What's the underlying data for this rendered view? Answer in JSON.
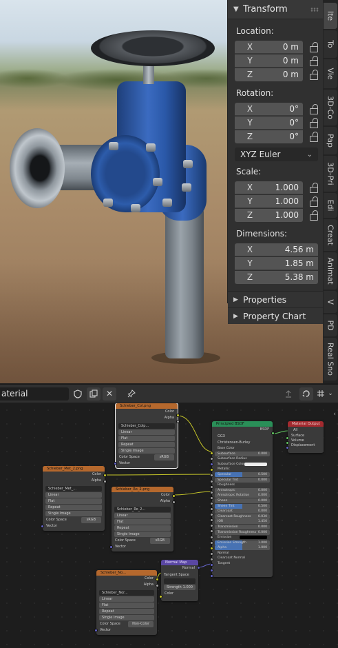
{
  "npanel": {
    "transform_title": "Transform",
    "location_label": "Location:",
    "location": [
      {
        "axis": "X",
        "value": "0 m"
      },
      {
        "axis": "Y",
        "value": "0 m"
      },
      {
        "axis": "Z",
        "value": "0 m"
      }
    ],
    "rotation_label": "Rotation:",
    "rotation": [
      {
        "axis": "X",
        "value": "0°"
      },
      {
        "axis": "Y",
        "value": "0°"
      },
      {
        "axis": "Z",
        "value": "0°"
      }
    ],
    "rotation_mode": "XYZ Euler",
    "scale_label": "Scale:",
    "scale": [
      {
        "axis": "X",
        "value": "1.000"
      },
      {
        "axis": "Y",
        "value": "1.000"
      },
      {
        "axis": "Z",
        "value": "1.000"
      }
    ],
    "dimensions_label": "Dimensions:",
    "dimensions": [
      {
        "axis": "X",
        "value": "4.56 m"
      },
      {
        "axis": "Y",
        "value": "1.85 m"
      },
      {
        "axis": "Z",
        "value": "5.38 m"
      }
    ],
    "properties_label": "Properties",
    "property_chart_label": "Property Chart"
  },
  "vtabs": [
    "Ite",
    "To",
    "Vie",
    "3D-Co",
    "Pap",
    "3D-Pri",
    "Edi",
    "Creat",
    "Animat",
    "V",
    "PD",
    "Real Sno"
  ],
  "node_header": {
    "material_name": "aterial"
  },
  "nodes": {
    "color_tex": {
      "title": "Schieber_Col.png",
      "out1": "Color",
      "out2": "Alpha",
      "image": "Schieber_Colp...",
      "interp": "Linear",
      "proj": "Flat",
      "ext": "Repeat",
      "source": "Single Image",
      "cs_label": "Color Space",
      "cs_value": "sRGB",
      "vector": "Vector"
    },
    "met_tex": {
      "title": "Schieber_Met_2.png",
      "out1": "Color",
      "out2": "Alpha",
      "image": "Schieber_Met_...",
      "interp": "Linear",
      "proj": "Flat",
      "ext": "Repeat",
      "source": "Single Image",
      "cs_label": "Color Space",
      "cs_value": "sRGB",
      "vector": "Vector"
    },
    "ro_tex": {
      "title": "Schieber_Ro_2.png",
      "out1": "Color",
      "out2": "Alpha",
      "image": "Schieber_Ro_2...",
      "interp": "Linear",
      "proj": "Flat",
      "ext": "Repeat",
      "source": "Single Image",
      "cs_label": "Color Space",
      "cs_value": "sRGB",
      "vector": "Vector"
    },
    "nor_tex": {
      "title": "Schieber_No...",
      "out1": "Color",
      "out2": "Alpha",
      "image": "Schieber_Nor...",
      "interp": "Linear",
      "proj": "Flat",
      "ext": "Repeat",
      "source": "Single Image",
      "cs_label": "Color Space",
      "cs_value": "Non-Color",
      "vector": "Vector"
    },
    "normal_map": {
      "title": "Normal Map",
      "out": "Normal",
      "space": "Tangent Space",
      "uv": "",
      "strength_label": "Strength",
      "strength": "1.000",
      "color": "Color"
    },
    "bsdf": {
      "title": "Principled BSDF",
      "out": "BSDF",
      "dist": "GGX",
      "sss": "Christensen-Burley",
      "inputs": [
        {
          "label": "Base Color",
          "value": ""
        },
        {
          "label": "Subsurface",
          "value": "0.000"
        },
        {
          "label": "Subsurface Radius",
          "value": ""
        },
        {
          "label": "Subsurface Color",
          "value": ""
        },
        {
          "label": "Metallic",
          "value": ""
        },
        {
          "label": "Specular",
          "value": "0.500"
        },
        {
          "label": "Specular Tint",
          "value": "0.000"
        },
        {
          "label": "Roughness",
          "value": ""
        },
        {
          "label": "Anisotropic",
          "value": "0.000"
        },
        {
          "label": "Anisotropic Rotation",
          "value": "0.000"
        },
        {
          "label": "Sheen",
          "value": "0.000"
        },
        {
          "label": "Sheen Tint",
          "value": "0.500"
        },
        {
          "label": "Clearcoat",
          "value": "0.000"
        },
        {
          "label": "Clearcoat Roughness",
          "value": "0.030"
        },
        {
          "label": "IOR",
          "value": "1.450"
        },
        {
          "label": "Transmission",
          "value": "0.000"
        },
        {
          "label": "Transmission Roughness",
          "value": "0.000"
        },
        {
          "label": "Emission",
          "value": ""
        },
        {
          "label": "Emission Strength",
          "value": "1.000"
        },
        {
          "label": "Alpha",
          "value": "1.000"
        },
        {
          "label": "Normal",
          "value": ""
        },
        {
          "label": "Clearcoat Normal",
          "value": ""
        },
        {
          "label": "Tangent",
          "value": ""
        }
      ]
    },
    "output": {
      "title": "Material Output",
      "target": "All",
      "surface": "Surface",
      "volume": "Volume",
      "displacement": "Displacement"
    }
  },
  "colors": {
    "texture_header": "#b5682d",
    "shader_header": "#2a8f58",
    "output_header": "#a42a2f",
    "vector_header": "#5a47a3",
    "color_socket": "#c7c729",
    "float_socket": "#a1a1a1",
    "vector_socket": "#6363c7",
    "shader_socket": "#63c763"
  }
}
